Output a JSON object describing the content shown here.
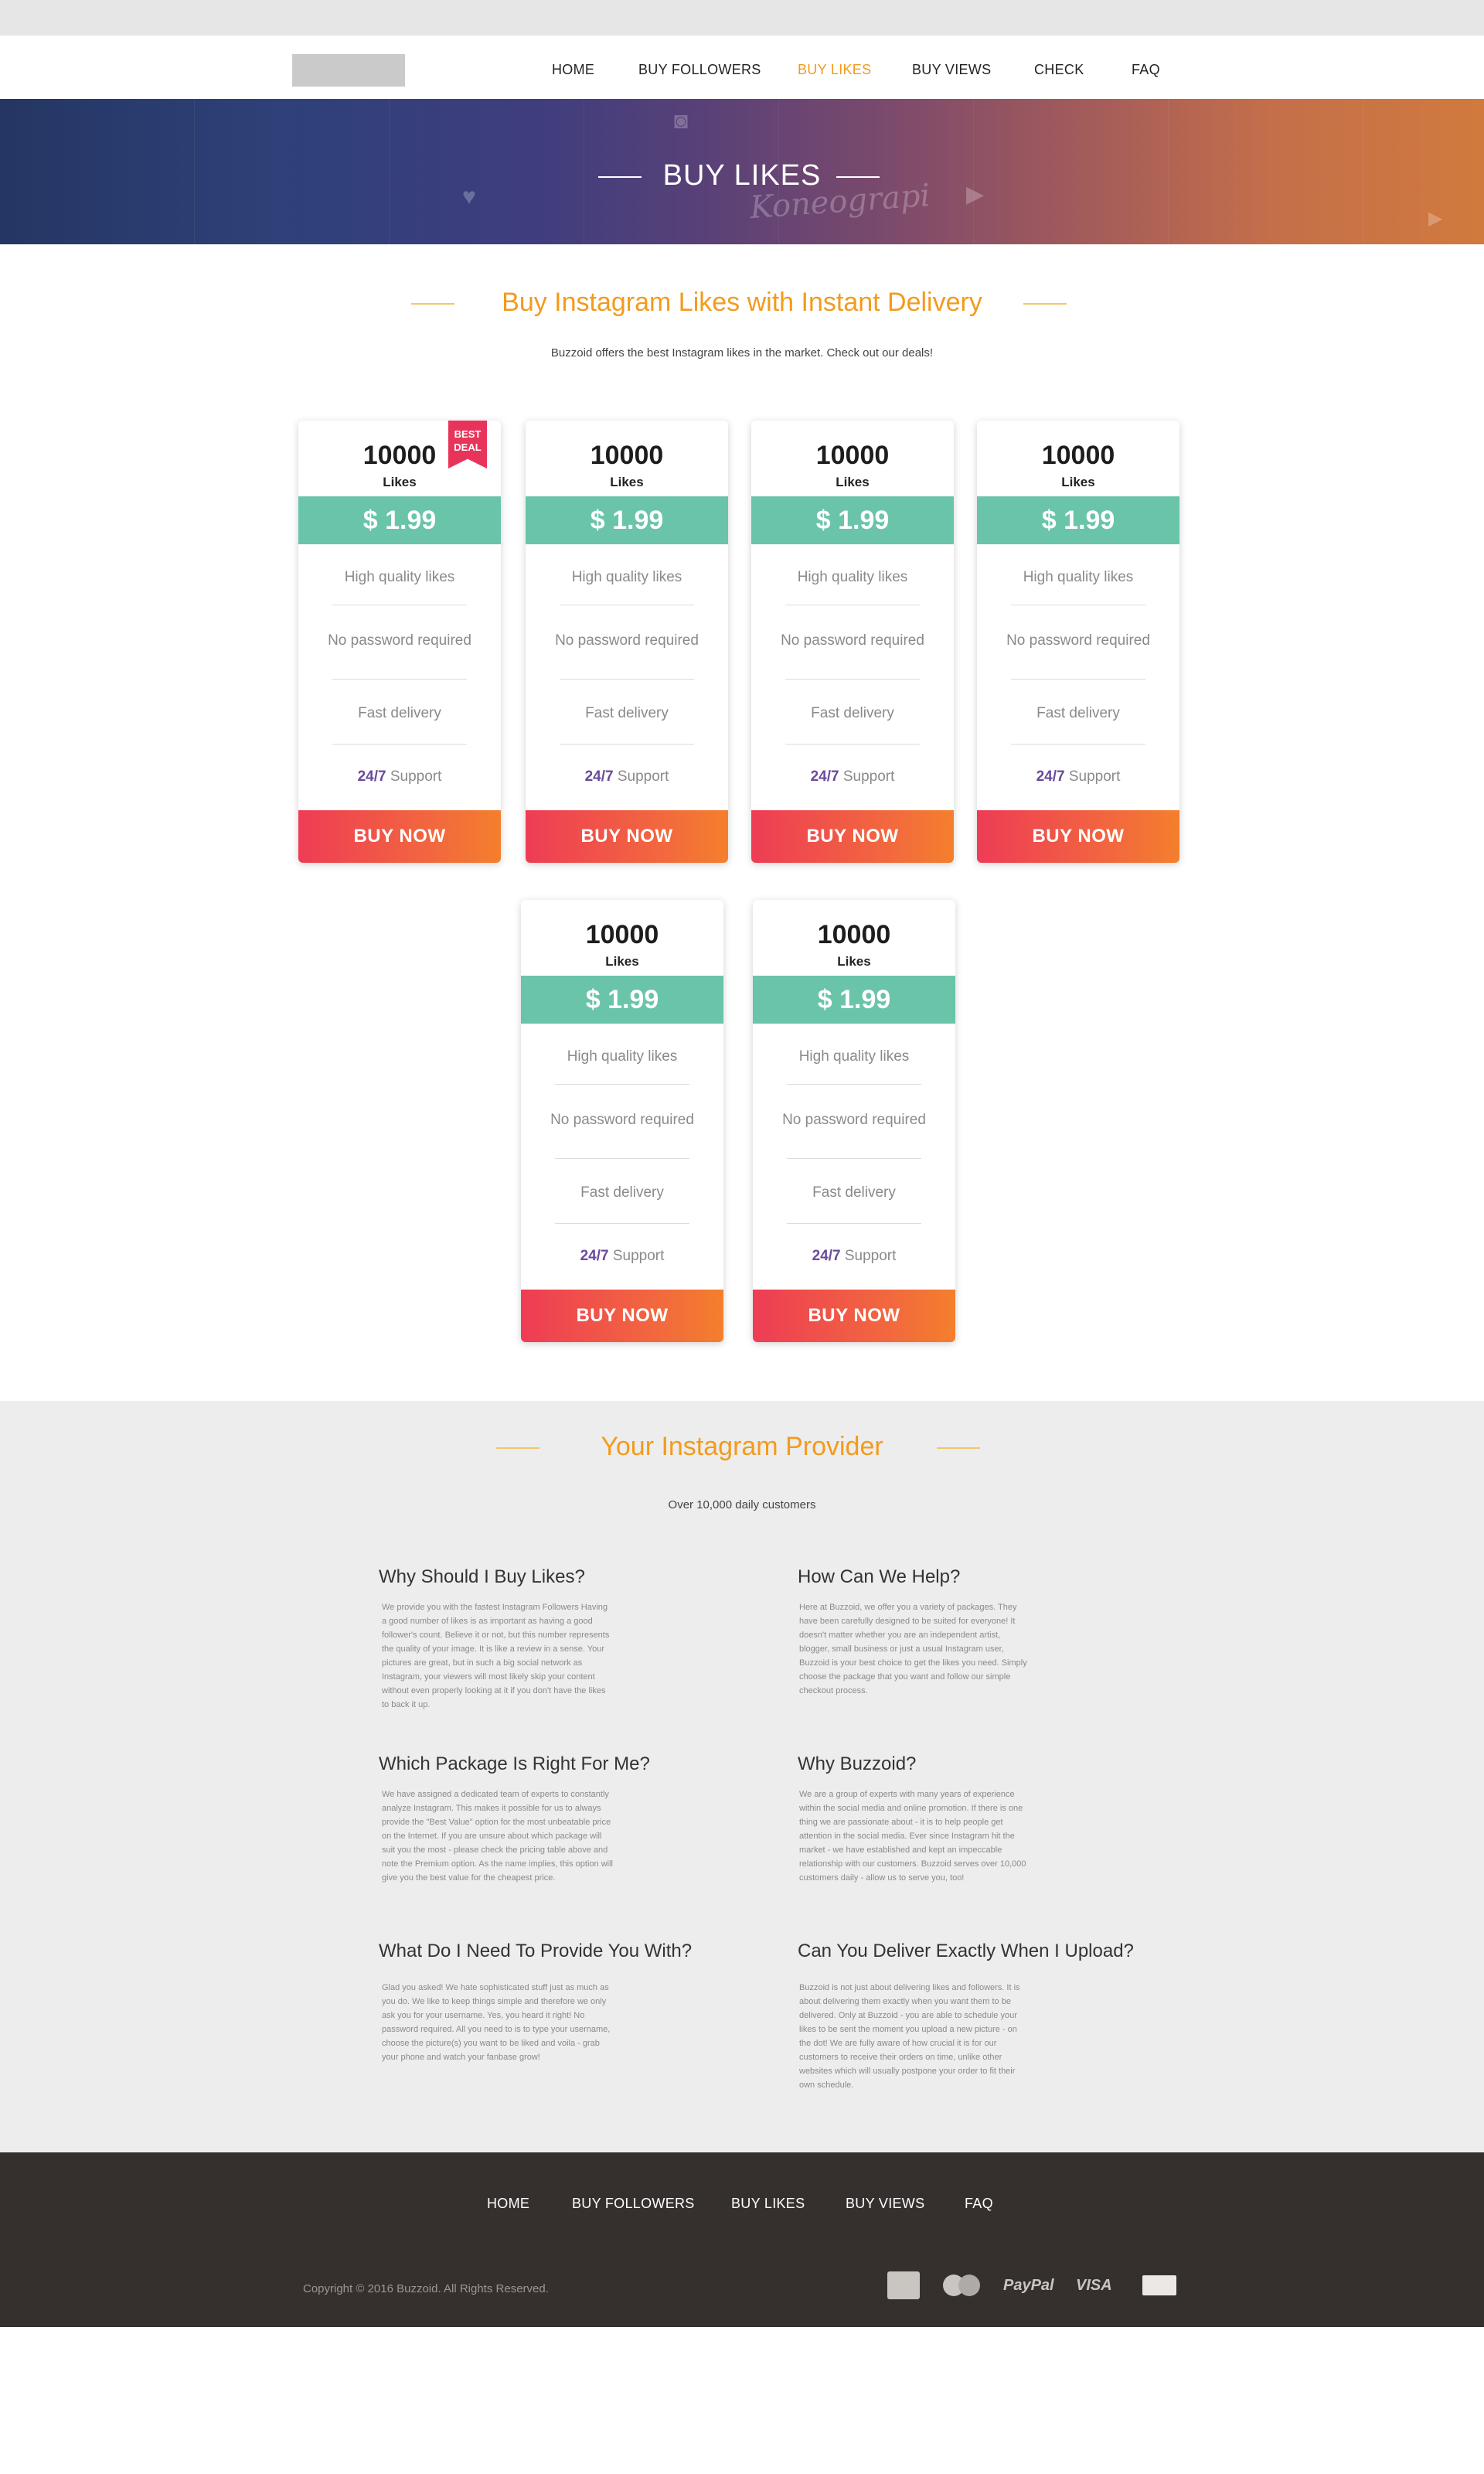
{
  "header": {
    "nav": [
      {
        "label": "HOME",
        "active": false
      },
      {
        "label": "BUY FOLLOWERS",
        "active": false
      },
      {
        "label": "BUY LIKES",
        "active": true
      },
      {
        "label": "BUY VIEWS",
        "active": false
      },
      {
        "label": "CHECK",
        "active": false
      },
      {
        "label": "FAQ",
        "active": false
      }
    ],
    "accent_color": "#f29b1d"
  },
  "hero": {
    "title": "BUY LIKES",
    "watermark": "Koneograpi"
  },
  "pricing": {
    "title": "Buy Instagram Likes with Instant Delivery",
    "subtitle": "Buzzoid offers the best Instagram likes in the market. Check out our deals!",
    "cards": [
      {
        "qty": "10000",
        "unit": "Likes",
        "price": "$ 1.99",
        "badge_line1": "BEST",
        "badge_line2": "DEAL",
        "f1": "High quality likes",
        "f2": "No password required",
        "f3": "Fast delivery",
        "support_strong": "24/7",
        "support_rest": " Support",
        "button": "BUY NOW"
      },
      {
        "qty": "10000",
        "unit": "Likes",
        "price": "$ 1.99",
        "f1": "High quality likes",
        "f2": "No password required",
        "f3": "Fast delivery",
        "support_strong": "24/7",
        "support_rest": " Support",
        "button": "BUY NOW"
      },
      {
        "qty": "10000",
        "unit": "Likes",
        "price": "$ 1.99",
        "f1": "High quality likes",
        "f2": "No password required",
        "f3": "Fast delivery",
        "support_strong": "24/7",
        "support_rest": " Support",
        "button": "BUY NOW"
      },
      {
        "qty": "10000",
        "unit": "Likes",
        "price": "$ 1.99",
        "f1": "High quality likes",
        "f2": "No password required",
        "f3": "Fast delivery",
        "support_strong": "24/7",
        "support_rest": " Support",
        "button": "BUY NOW"
      },
      {
        "qty": "10000",
        "unit": "Likes",
        "price": "$ 1.99",
        "f1": "High quality likes",
        "f2": "No password required",
        "f3": "Fast delivery",
        "support_strong": "24/7",
        "support_rest": " Support",
        "button": "BUY NOW"
      },
      {
        "qty": "10000",
        "unit": "Likes",
        "price": "$ 1.99",
        "f1": "High quality likes",
        "f2": "No password required",
        "f3": "Fast delivery",
        "support_strong": "24/7",
        "support_rest": " Support",
        "button": "BUY NOW"
      }
    ],
    "price_bar_color": "#6ac4aa",
    "button_color": "#ee3c55"
  },
  "info": {
    "title": "Your  Instagram Provider",
    "subtitle": "Over 10,000 daily customers",
    "items": [
      {
        "heading": "Why Should I Buy Likes?",
        "text": "We provide you with the fastest Instagram Followers Having a good number of likes is as important as having a good follower's count. Believe it or not, but this number represents the quality of your image. It is like a review in a sense. Your pictures are great, but in such a big social network as Instagram, your viewers will most likely skip your content without even properly looking at it if you don't have the likes to back it up."
      },
      {
        "heading": "How Can We Help?",
        "text": "Here at Buzzoid, we offer you a variety of packages. They have been carefully designed to be suited for everyone! It doesn't matter whether you are an independent artist, blogger, small business or just a usual Instagram user, Buzzoid is your best choice to get the likes you need. Simply choose the package that you want and follow our simple checkout process."
      },
      {
        "heading": "Which Package Is Right For Me?",
        "text": "We have assigned a dedicated team of experts to constantly analyze Instagram. This makes it possible for us to always provide the \"Best Value\" option for the most unbeatable price on the Internet. If you are unsure about which package will suit you the most - please check the pricing table above and note the Premium option. As the name implies, this option will give you the best value for the cheapest price."
      },
      {
        "heading": "Why Buzzoid?",
        "text": "We are a group of experts with many years of experience within the social media and online promotion. If there is one thing we are passionate about - it is to help people get attention in the social media. Ever since Instagram hit the market - we have established and kept an impeccable relationship with our customers. Buzzoid serves over 10,000 customers daily - allow us to serve you, too!"
      },
      {
        "heading": "What Do I Need To Provide You With?",
        "text": "Glad you asked! We hate sophisticated stuff just as much as you do. We like to keep things simple and therefore we only ask you for your username. Yes, you heard it right! No password required. All you need to is to type your username, choose the picture(s) you want to be liked and voila - grab your phone and watch your fanbase grow!"
      },
      {
        "heading": "Can You Deliver Exactly When I Upload?",
        "text": "Buzzoid is not just about delivering likes and followers. It is about delivering them exactly when you want them to be delivered. Only at Buzzoid - you are able to schedule your likes to be sent the moment you upload a new picture - on the dot! We are fully aware of how crucial it is for our customers to receive their orders on time, unlike other websites which will usually postpone your order to fit their own schedule."
      }
    ]
  },
  "footer": {
    "nav": [
      "HOME",
      "BUY FOLLOWERS",
      "BUY LIKES",
      "BUY VIEWS",
      "FAQ"
    ],
    "copyright": "Copyright © 2016 Buzzoid. All Rights Reserved.",
    "payments": [
      "amex-icon",
      "mastercard-icon",
      "PayPal",
      "VISA",
      "discover-icon"
    ]
  }
}
